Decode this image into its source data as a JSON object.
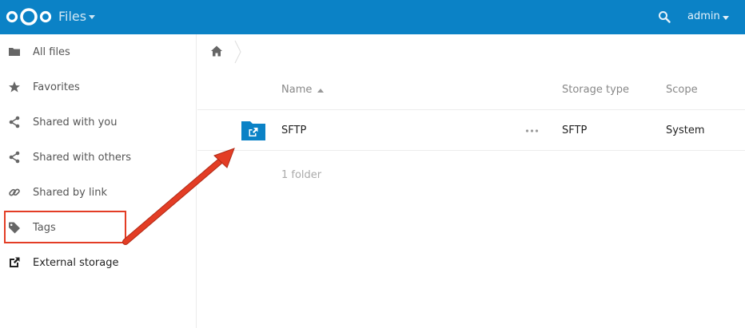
{
  "header": {
    "app_title": "Files",
    "user": "admin",
    "icons": {
      "logo": "nextcloud-logo",
      "search": "search-icon"
    },
    "color": "#0b82c6"
  },
  "sidebar": {
    "items": [
      {
        "label": "All files",
        "icon": "folder-icon"
      },
      {
        "label": "Favorites",
        "icon": "star-icon"
      },
      {
        "label": "Shared with you",
        "icon": "share-icon"
      },
      {
        "label": "Shared with others",
        "icon": "share-icon"
      },
      {
        "label": "Shared by link",
        "icon": "link-icon"
      },
      {
        "label": "Tags",
        "icon": "tag-icon"
      },
      {
        "label": "External storage",
        "icon": "external-link-icon"
      }
    ],
    "active": "External storage"
  },
  "table": {
    "columns": [
      "Name",
      "Storage type",
      "Scope"
    ],
    "sort": {
      "column": "Name",
      "direction": "ascending"
    },
    "rows": [
      {
        "name": "SFTP",
        "storage_type": "SFTP",
        "scope": "System",
        "icon": "external-folder-icon"
      }
    ],
    "summary": "1 folder"
  },
  "annotation": {
    "color": "#e33d25"
  }
}
